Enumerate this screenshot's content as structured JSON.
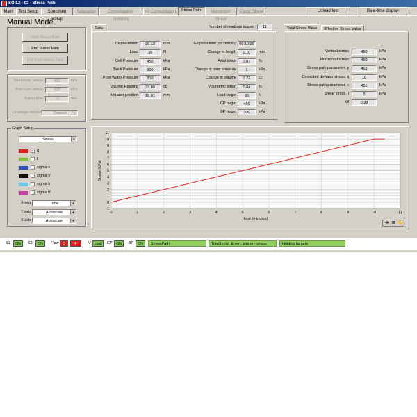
{
  "window": {
    "title": "SOIL2 - 03 - Stress Path"
  },
  "tabs": [
    "Main",
    "Test Setup",
    "Specimen Setup",
    "Saturation",
    "Consolidation Isotropic",
    "K0 Consolidation",
    "Stress Path",
    "Monotonic Shear",
    "Cyclic Shear"
  ],
  "top_buttons": {
    "unload": "Unload test",
    "realtime": "Real-time display"
  },
  "manual": {
    "title": "Manual Mode",
    "start": "Start Stress Path",
    "end": "End Stress Path",
    "exit": "Exit from Stress Path"
  },
  "targets": {
    "horiz_label": "Total horiz. stress",
    "horiz_value": "450",
    "horiz_unit": "kPa",
    "vert_label": "Total vert. stress",
    "vert_value": "460",
    "vert_unit": "kPa",
    "ramp_label": "Ramp time",
    "ramp_value": "10",
    "ramp_unit": "min",
    "drainage_label": "Drainage method",
    "drainage_value": "Drained"
  },
  "graph_setup": {
    "title": "Graph Setup",
    "mode": "Stress",
    "series": [
      {
        "label": "q",
        "color": "#e02020",
        "checked": "✓"
      },
      {
        "label": "t",
        "color": "#80c040",
        "checked": ""
      },
      {
        "label": "sigma v",
        "color": "#3050c0",
        "checked": ""
      },
      {
        "label": "sigma v'",
        "color": "#101010",
        "checked": ""
      },
      {
        "label": "sigma h",
        "color": "#70c8e8",
        "checked": ""
      },
      {
        "label": "sigma h'",
        "color": "#c040a0",
        "checked": ""
      }
    ],
    "xaxis_label": "X-axis",
    "xaxis_value": "Time",
    "yaxis_label": "Y axis",
    "yaxis_value": "Autoscale",
    "xaxis2_label": "X axis",
    "xaxis2_value": "Autoscale"
  },
  "data_panel": {
    "tab": "Data",
    "readings_label": "Number of readings logged:",
    "readings_value": "11",
    "left": [
      {
        "label": "Displacement",
        "value": "30.13",
        "unit": "mm"
      },
      {
        "label": "Load",
        "value": "39",
        "unit": "N"
      },
      {
        "label": "Cell Pressure",
        "value": "450",
        "unit": "kPa"
      },
      {
        "label": "Back Pressure",
        "value": "300",
        "unit": "kPa"
      },
      {
        "label": "Pore Water Pressure",
        "value": "310",
        "unit": "kPa"
      },
      {
        "label": "Volume Reading",
        "value": "33.80",
        "unit": "cc"
      },
      {
        "label": "Actuator position",
        "value": "18.91",
        "unit": "mm"
      }
    ],
    "right": [
      {
        "label": "Elapsed time (hh:mm:ss)",
        "value": "00:10:26",
        "unit": ""
      },
      {
        "label": "Change in length",
        "value": "0.10",
        "unit": "mm"
      },
      {
        "label": "Axial strain",
        "value": "0.07",
        "unit": "%"
      },
      {
        "label": "Change in pore pressure",
        "value": "1",
        "unit": "kPa"
      },
      {
        "label": "Change in volume",
        "value": "0.22",
        "unit": "cc"
      },
      {
        "label": "Volumetric strain",
        "value": "0.04",
        "unit": "%"
      },
      {
        "label": "Load target",
        "value": "38",
        "unit": "N"
      },
      {
        "label": "CP target",
        "value": "450",
        "unit": "kPa"
      },
      {
        "label": "BP target",
        "value": "300",
        "unit": "kPa"
      }
    ]
  },
  "stress_panel": {
    "tab1": "Total Stress Value",
    "tab2": "Effective Stress Value",
    "rows": [
      {
        "label": "Vertical stress",
        "value": "460",
        "unit": "kPa"
      },
      {
        "label": "Horizontal stress",
        "value": "450",
        "unit": "kPa"
      },
      {
        "label": "Stress path parameter, p",
        "value": "453",
        "unit": "kPa"
      },
      {
        "label": "Corrected deviator stress, q",
        "value": "10",
        "unit": "kPa"
      },
      {
        "label": "Stress path parameter, s",
        "value": "455",
        "unit": "kPa"
      },
      {
        "label": "Shear stress, t",
        "value": "5",
        "unit": "kPa"
      },
      {
        "label": "k0",
        "value": "0.98",
        "unit": ""
      }
    ]
  },
  "chart_data": {
    "type": "line",
    "xlabel": "time (minutes)",
    "ylabel": "Stress (kPa)",
    "xlim": [
      0,
      11
    ],
    "ylim": [
      -1,
      11
    ],
    "xticks": [
      "0",
      "1",
      "2",
      "3",
      "4",
      "5",
      "6",
      "7",
      "8",
      "9",
      "10",
      "11"
    ],
    "yticks": [
      "-1",
      "0",
      "1",
      "2",
      "3",
      "4",
      "5",
      "6",
      "7",
      "8",
      "9",
      "10",
      "11"
    ],
    "grid": true,
    "series": [
      {
        "color": "#e02020",
        "points": [
          [
            0,
            0
          ],
          [
            10,
            10
          ],
          [
            10.4,
            10
          ]
        ]
      }
    ]
  },
  "status": {
    "s1_label": "S1",
    "s1_state": "ON",
    "s2_label": "S2",
    "s2_state": "ON",
    "flow_label": "Flow",
    "flow_a": "O",
    "flow_b": "F",
    "v_label": "V",
    "v_state": "Load",
    "cp_label": "CP",
    "cp_state": "ON",
    "bp_label": "BP",
    "bp_state": "ON",
    "bar1": "StressPath",
    "bar2": "Total horiz. & vert. stress - stress",
    "bar3": "Holding targets"
  }
}
